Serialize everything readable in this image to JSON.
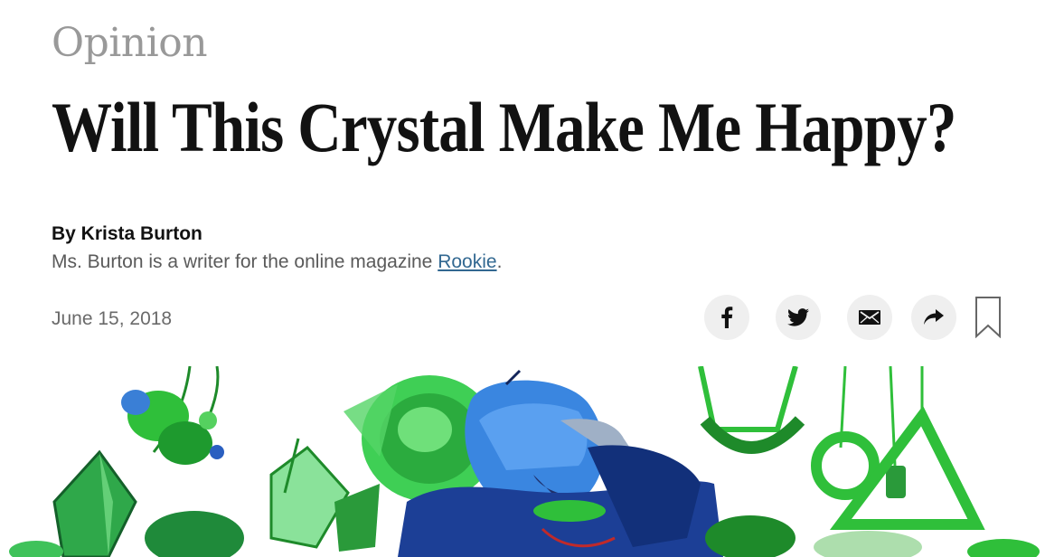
{
  "article": {
    "kicker": "Opinion",
    "headline": "Will This Crystal Make Me Happy?",
    "byline": "By Krista Burton",
    "bio_prefix": "Ms. Burton is a writer for the online magazine ",
    "bio_link": "Rookie",
    "bio_suffix": ".",
    "date": "June 15, 2018"
  },
  "share": {
    "buttons": [
      {
        "icon": "facebook-icon"
      },
      {
        "icon": "twitter-icon"
      },
      {
        "icon": "email-icon"
      },
      {
        "icon": "share-arrow-icon"
      }
    ],
    "bookmark_icon": "bookmark-icon"
  },
  "colors": {
    "kicker": "#999999",
    "headline": "#121212",
    "link": "#326891",
    "share_bg": "#efefef",
    "illustration_green": "#2fbf3a",
    "illustration_blue": "#2f6fd6"
  }
}
